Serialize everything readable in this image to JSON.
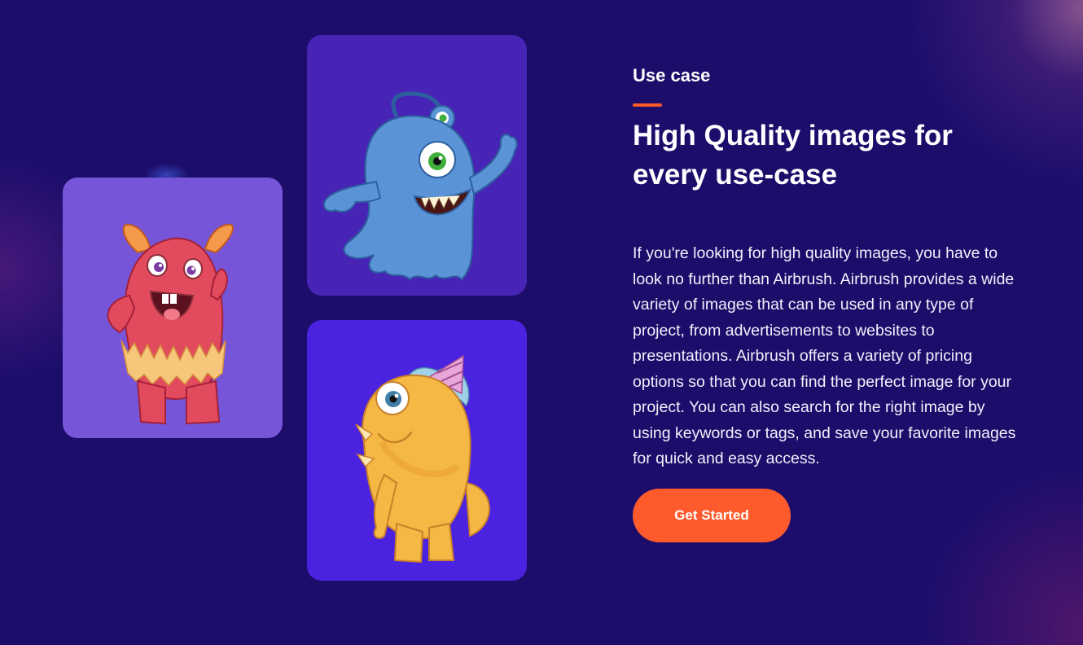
{
  "section": {
    "eyebrow": "Use case",
    "headline": "High Quality images for every use-case",
    "body": "If you're looking for high quality images, you have to look no further than Airbrush. Airbrush provides a wide variety of images that can be used in any type of project, from advertisements to websites to presentations. Airbrush offers a variety of pricing options so that you can find the perfect image for your project. You can also search for the right image by using keywords or tags, and save your favorite images for quick and easy access.",
    "cta_label": "Get Started"
  },
  "gallery": [
    {
      "name": "red-monster",
      "card_color": "#7655d9"
    },
    {
      "name": "blue-monster",
      "card_color": "#4724b6"
    },
    {
      "name": "orange-monster",
      "card_color": "#4a22e0"
    }
  ],
  "colors": {
    "background": "#1c0d6b",
    "accent": "#ff5a2c",
    "text": "#ffffff"
  }
}
